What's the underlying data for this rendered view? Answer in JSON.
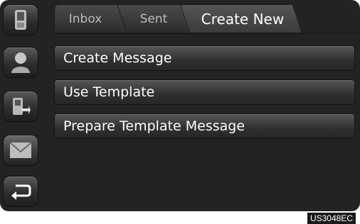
{
  "tabs": [
    {
      "label": "Inbox"
    },
    {
      "label": "Sent"
    },
    {
      "label": "Create New",
      "active": true
    }
  ],
  "menu": [
    {
      "label": "Create Message"
    },
    {
      "label": "Use Template"
    },
    {
      "label": "Prepare Template Message"
    }
  ],
  "sidebar": {
    "icons": [
      "phone-icon",
      "contact-icon",
      "transfer-icon",
      "message-icon",
      "back-icon"
    ]
  },
  "reference_code": "US3048EC",
  "colors": {
    "screen_bg": "#232323",
    "button_top": "#5a5a5a",
    "button_bottom": "#1e1e1e",
    "text": "#ffffff",
    "inactive_tab_text": "#bdbdbd"
  }
}
